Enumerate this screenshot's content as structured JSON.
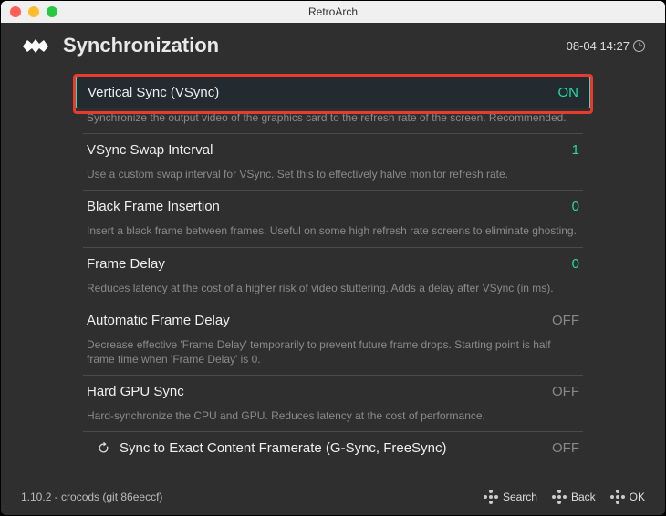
{
  "window": {
    "title": "RetroArch"
  },
  "header": {
    "title": "Synchronization",
    "clock": "08-04 14:27"
  },
  "settings": [
    {
      "label": "Vertical Sync (VSync)",
      "value": "ON",
      "vclass": "on",
      "desc": "Synchronize the output video of the graphics card to the refresh rate of the screen. Recommended.",
      "selected": true,
      "highlight": true
    },
    {
      "label": "VSync Swap Interval",
      "value": "1",
      "vclass": "num",
      "desc": "Use a custom swap interval for VSync. Set this to effectively halve monitor refresh rate."
    },
    {
      "label": "Black Frame Insertion",
      "value": "0",
      "vclass": "num",
      "desc": "Insert a black frame between frames. Useful on some high refresh rate screens to eliminate ghosting."
    },
    {
      "label": "Frame Delay",
      "value": "0",
      "vclass": "num",
      "desc": "Reduces latency at the cost of a higher risk of video stuttering. Adds a delay after VSync (in ms)."
    },
    {
      "label": "Automatic Frame Delay",
      "value": "OFF",
      "vclass": "off",
      "desc": "Decrease effective 'Frame Delay' temporarily to prevent future frame drops. Starting point is half frame time when 'Frame Delay' is 0."
    },
    {
      "label": "Hard GPU Sync",
      "value": "OFF",
      "vclass": "off",
      "desc": "Hard-synchronize the CPU and GPU. Reduces latency at the cost of performance."
    },
    {
      "label": "Sync to Exact Content Framerate (G-Sync, FreeSync)",
      "value": "OFF",
      "vclass": "off",
      "desc": "",
      "sub": true
    }
  ],
  "footer": {
    "version": "1.10.2 - crocods (git 86eeccf)",
    "buttons": [
      {
        "label": "Search"
      },
      {
        "label": "Back"
      },
      {
        "label": "OK"
      }
    ]
  }
}
